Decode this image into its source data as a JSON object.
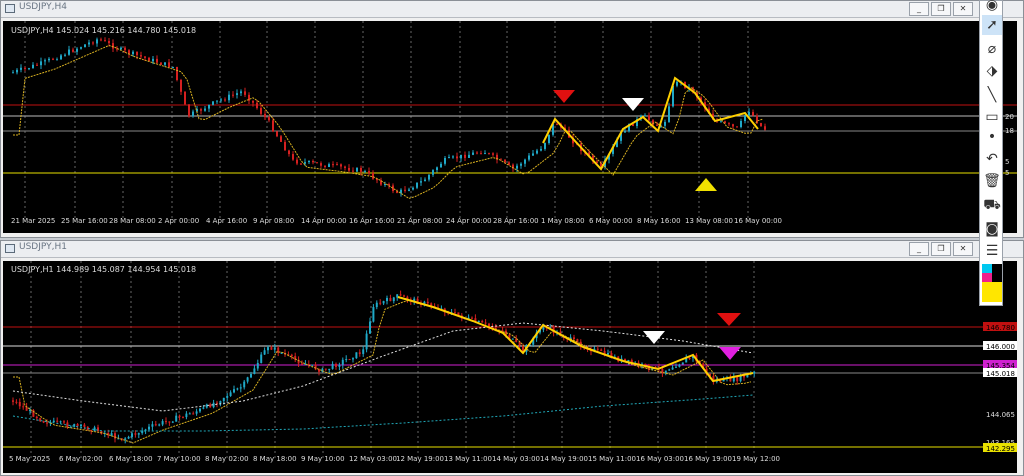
{
  "top": {
    "window_title": "USDJPY,H4",
    "info": "USDJPY,H4  145.024 145.216 144.780 145.018",
    "xlabels": [
      "21 Mar 2025",
      "25 Mar 16:00",
      "28 Mar 08:00",
      "2 Apr 00:00",
      "4 Apr 16:00",
      "9 Apr 08:00",
      "14 Apr 00:00",
      "16 Apr 16:00",
      "21 Apr 08:00",
      "24 Apr 00:00",
      "28 Apr 16:00",
      "1 May 08:00",
      "6 May 00:00",
      "8 May 16:00",
      "13 May 08:00",
      "16 May 00:00"
    ],
    "right_labels": [
      "20",
      "18",
      "5",
      "5"
    ]
  },
  "bottom": {
    "window_title": "USDJPY,H1",
    "info": "USDJPY,H1  144.989 145.087 144.954 145.018",
    "xlabels": [
      "5 May 2025",
      "6 May 02:00",
      "6 May 18:00",
      "7 May 10:00",
      "8 May 02:00",
      "8 May 18:00",
      "9 May 10:00",
      "12 May 03:00",
      "12 May 19:00",
      "13 May 11:00",
      "14 May 03:00",
      "14 May 19:00",
      "15 May 11:00",
      "16 May 03:00",
      "16 May 19:00",
      "19 May 12:00"
    ],
    "price_labels": {
      "red_line": "146.780",
      "white_line": "146.000",
      "magenta_line": "145.354",
      "current": "145.018",
      "scale1": "144.065",
      "scale2": "143.165",
      "yellow_line": "142.295"
    }
  },
  "window_buttons": {
    "minimize": "_",
    "restore": "❐",
    "close": "✕"
  },
  "toolbar_tools": [
    "eye-icon",
    "cursor-icon",
    "crosshair-icon",
    "tag-icon",
    "line-icon",
    "ruler-icon",
    "dot-icon",
    "undo-icon",
    "trash-icon",
    "cart-icon",
    "camera-icon",
    "notes-icon",
    "color-palette-icon"
  ],
  "colors": {
    "bull": "#1fa9c8",
    "bear": "#d62020",
    "zigzag": "#ffd000",
    "ma": "#d8b020",
    "red_line": "#c01010",
    "magenta": "#d020d0"
  }
}
